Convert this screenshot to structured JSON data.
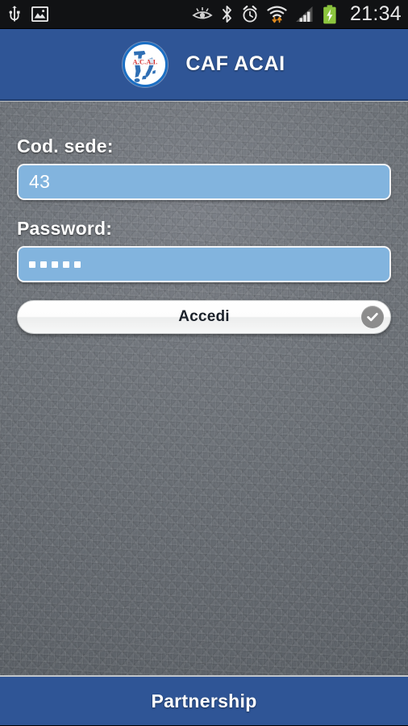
{
  "status_bar": {
    "left_icons": [
      {
        "name": "usb-icon",
        "label": "USB"
      },
      {
        "name": "screenshot-image-icon",
        "label": "Screenshot saved"
      }
    ],
    "right_icons": [
      {
        "name": "smart-stay-eye-icon",
        "label": "Smart stay"
      },
      {
        "name": "bluetooth-icon",
        "label": "Bluetooth"
      },
      {
        "name": "alarm-clock-icon",
        "label": "Alarm"
      },
      {
        "name": "wifi-data-transfer-icon",
        "label": "Wi-Fi"
      },
      {
        "name": "cellular-signal-icon",
        "label": "Signal"
      },
      {
        "name": "battery-charging-icon",
        "label": "Battery charging"
      }
    ],
    "time": "21:34",
    "background": "#111214",
    "text_color": "#e8e8e8",
    "battery_color": "#8cc63e"
  },
  "header": {
    "title": "CAF ACAI",
    "logo": {
      "name": "caf-acai-logo-icon",
      "alt": "CAF ACAI logo: map of Italy with A.C.A.I. lettering",
      "map_color": "#2f6fb5",
      "text_color": "#d62b2b",
      "text": "A.C.A.I."
    },
    "background": "#2f5596",
    "text_color": "#ffffff"
  },
  "form": {
    "fields": [
      {
        "name": "cod-sede",
        "label": "Cod. sede:",
        "value": "43",
        "placeholder": "",
        "masked": false,
        "type": "text"
      },
      {
        "name": "password",
        "label": "Password:",
        "value": "•••••",
        "placeholder": "",
        "masked": true,
        "mask_length": 5,
        "type": "password"
      }
    ],
    "submit": {
      "label": "Accedi",
      "icon": "check-circle-icon",
      "background": "#ffffff",
      "text_color": "#1c222b",
      "icon_background": "#8c8c8c"
    },
    "input_fill": "#82b4de",
    "input_border": "#f2f4f6",
    "label_color": "#ffffff"
  },
  "footer": {
    "label": "Partnership",
    "background": "#2f5596",
    "text_color": "#ffffff"
  },
  "theme": {
    "accent_blue": "#2f5596",
    "field_blue": "#82b4de",
    "texture_gray": "#6f747a"
  }
}
